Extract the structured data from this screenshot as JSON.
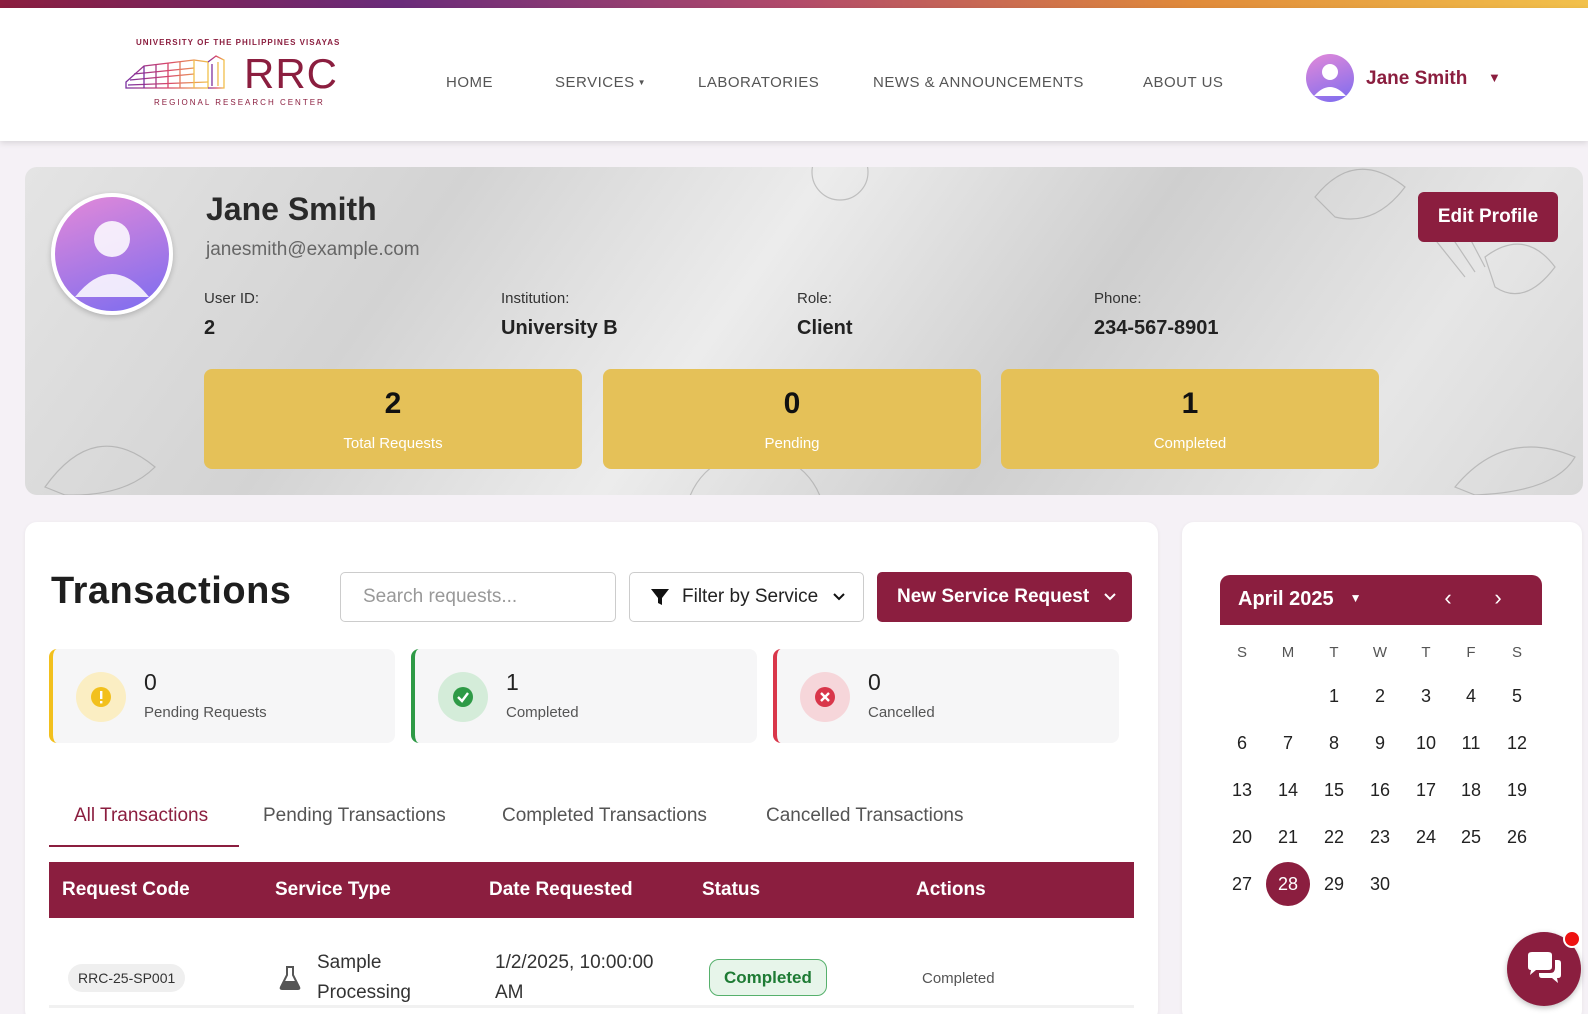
{
  "header": {
    "logo": {
      "top_text": "UNIVERSITY OF THE PHILIPPINES VISAYAS",
      "main_text": "RRC",
      "bottom_text": "REGIONAL RESEARCH CENTER"
    },
    "nav": [
      {
        "label": "HOME"
      },
      {
        "label": "SERVICES"
      },
      {
        "label": "LABORATORIES"
      },
      {
        "label": "NEWS & ANNOUNCEMENTS"
      },
      {
        "label": "ABOUT US"
      }
    ],
    "user_name": "Jane Smith"
  },
  "profile": {
    "name": "Jane Smith",
    "email": "janesmith@example.com",
    "edit_label": "Edit Profile",
    "fields": [
      {
        "label": "User ID:",
        "value": "2"
      },
      {
        "label": "Institution:",
        "value": "University B"
      },
      {
        "label": "Role:",
        "value": "Client"
      },
      {
        "label": "Phone:",
        "value": "234-567-8901"
      }
    ],
    "stats": [
      {
        "value": "2",
        "label": "Total Requests"
      },
      {
        "value": "0",
        "label": "Pending"
      },
      {
        "value": "1",
        "label": "Completed"
      }
    ]
  },
  "transactions": {
    "title": "Transactions",
    "search_placeholder": "Search requests...",
    "filter_label": "Filter by Service",
    "new_request_label": "New Service Request",
    "summary": [
      {
        "value": "0",
        "label": "Pending Requests",
        "color": "#f2c01d"
      },
      {
        "value": "1",
        "label": "Completed",
        "color": "#2e9a46"
      },
      {
        "value": "0",
        "label": "Cancelled",
        "color": "#d9364a"
      }
    ],
    "tabs": [
      {
        "label": "All Transactions"
      },
      {
        "label": "Pending Transactions"
      },
      {
        "label": "Completed Transactions"
      },
      {
        "label": "Cancelled Transactions"
      }
    ],
    "columns": [
      "Request Code",
      "Service Type",
      "Date Requested",
      "Status",
      "Actions"
    ],
    "rows": [
      {
        "code": "RRC-25-SP001",
        "service": "Sample Processing",
        "date": "1/2/2025, 10:00:00 AM",
        "status": "Completed",
        "action": "Completed"
      }
    ]
  },
  "calendar": {
    "month_label": "April 2025",
    "weekdays": [
      "S",
      "M",
      "T",
      "W",
      "T",
      "F",
      "S"
    ],
    "first_weekday": 2,
    "days_in_month": 30,
    "today": 28
  },
  "colors": {
    "brand": "#8b1e3f",
    "gold": "#e5c158"
  },
  "icons": {
    "chat": "chat-bubbles-icon",
    "filter": "funnel-icon",
    "service": "flask-icon"
  }
}
